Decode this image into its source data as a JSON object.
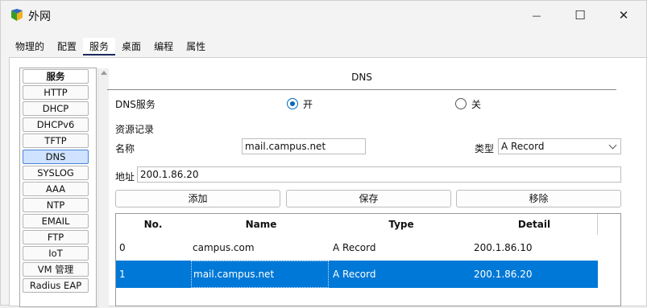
{
  "window": {
    "title": "外网",
    "controls": {
      "minimize": "—",
      "maximize": "☐",
      "close": "✕"
    }
  },
  "tabs": [
    {
      "label": "物理的"
    },
    {
      "label": "配置"
    },
    {
      "label": "服务",
      "active": true
    },
    {
      "label": "桌面"
    },
    {
      "label": "编程"
    },
    {
      "label": "属性"
    }
  ],
  "services": {
    "header": "服务",
    "items": [
      "HTTP",
      "DHCP",
      "DHCPv6",
      "TFTP",
      "DNS",
      "SYSLOG",
      "AAA",
      "NTP",
      "EMAIL",
      "FTP",
      "IoT",
      "VM 管理",
      "Radius EAP"
    ],
    "selected": "DNS"
  },
  "dns": {
    "title": "DNS",
    "service_label": "DNS服务",
    "on_label": "开",
    "off_label": "关",
    "service_state": "on",
    "records_label": "资源记录",
    "name_label": "名称",
    "name_value": "mail.campus.net",
    "type_label": "类型",
    "type_value": "A Record",
    "address_label": "地址",
    "address_value": "200.1.86.20",
    "add_button": "添加",
    "save_button": "保存",
    "remove_button": "移除"
  },
  "table": {
    "columns": [
      "No.",
      "Name",
      "Type",
      "Detail"
    ],
    "rows": [
      {
        "no": "0",
        "name": "campus.com",
        "type": "A Record",
        "detail": "200.1.86.10",
        "selected": false
      },
      {
        "no": "1",
        "name": "mail.campus.net",
        "type": "A Record",
        "detail": "200.1.86.20",
        "selected": true
      }
    ]
  },
  "colors": {
    "selection": "#0078d7",
    "radio_accent": "#0067c0"
  }
}
